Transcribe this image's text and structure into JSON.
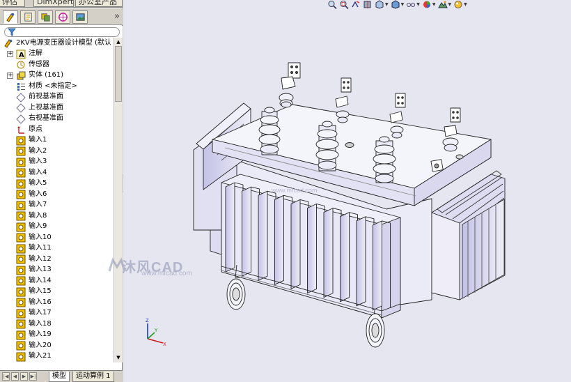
{
  "top_tabs": [
    "评估",
    "DimXpert",
    "办公室产品"
  ],
  "feature_tree": {
    "root": "2KV电源变压器设计模型  (默认",
    "items": [
      {
        "label": "注解",
        "expand": true,
        "icon": "annotation-icon"
      },
      {
        "label": "传感器",
        "expand": false,
        "icon": "sensor-icon"
      },
      {
        "label": "实体 (161)",
        "expand": true,
        "icon": "solid-bodies-icon"
      },
      {
        "label": "材质 <未指定>",
        "expand": false,
        "icon": "material-icon"
      },
      {
        "label": "前视基准面",
        "expand": false,
        "icon": "plane-icon"
      },
      {
        "label": "上视基准面",
        "expand": false,
        "icon": "plane-icon"
      },
      {
        "label": "右视基准面",
        "expand": false,
        "icon": "plane-icon"
      },
      {
        "label": "原点",
        "expand": false,
        "icon": "origin-icon"
      },
      {
        "label": "输入1",
        "expand": false,
        "icon": "imported-body-icon"
      },
      {
        "label": "输入2",
        "expand": false,
        "icon": "imported-body-icon"
      },
      {
        "label": "输入3",
        "expand": false,
        "icon": "imported-body-icon"
      },
      {
        "label": "输入4",
        "expand": false,
        "icon": "imported-body-icon"
      },
      {
        "label": "输入5",
        "expand": false,
        "icon": "imported-body-icon"
      },
      {
        "label": "输入6",
        "expand": false,
        "icon": "imported-body-icon"
      },
      {
        "label": "输入7",
        "expand": false,
        "icon": "imported-body-icon"
      },
      {
        "label": "输入8",
        "expand": false,
        "icon": "imported-body-icon"
      },
      {
        "label": "输入9",
        "expand": false,
        "icon": "imported-body-icon"
      },
      {
        "label": "输入10",
        "expand": false,
        "icon": "imported-body-icon"
      },
      {
        "label": "输入11",
        "expand": false,
        "icon": "imported-body-icon"
      },
      {
        "label": "输入12",
        "expand": false,
        "icon": "imported-body-icon"
      },
      {
        "label": "输入13",
        "expand": false,
        "icon": "imported-body-icon"
      },
      {
        "label": "输入14",
        "expand": false,
        "icon": "imported-body-icon"
      },
      {
        "label": "输入15",
        "expand": false,
        "icon": "imported-body-icon"
      },
      {
        "label": "输入16",
        "expand": false,
        "icon": "imported-body-icon"
      },
      {
        "label": "输入17",
        "expand": false,
        "icon": "imported-body-icon"
      },
      {
        "label": "输入18",
        "expand": false,
        "icon": "imported-body-icon"
      },
      {
        "label": "输入19",
        "expand": false,
        "icon": "imported-body-icon"
      },
      {
        "label": "输入20",
        "expand": false,
        "icon": "imported-body-icon"
      },
      {
        "label": "输入21",
        "expand": false,
        "icon": "imported-body-icon"
      }
    ]
  },
  "bottom_tabs": {
    "model": "模型",
    "motion": "运动算例 1"
  },
  "watermark": {
    "title": "沐风CAD",
    "url": "www.mfcad.com"
  },
  "viewport_watermark": "www.mfcad.com",
  "triad_labels": {
    "x": "X",
    "y": "Y",
    "z": "Z"
  },
  "colors": {
    "body": "#e4e3f5",
    "edge": "#222222",
    "viewport_bg": "#e5e6f0",
    "imported_icon": "#f2c200"
  }
}
